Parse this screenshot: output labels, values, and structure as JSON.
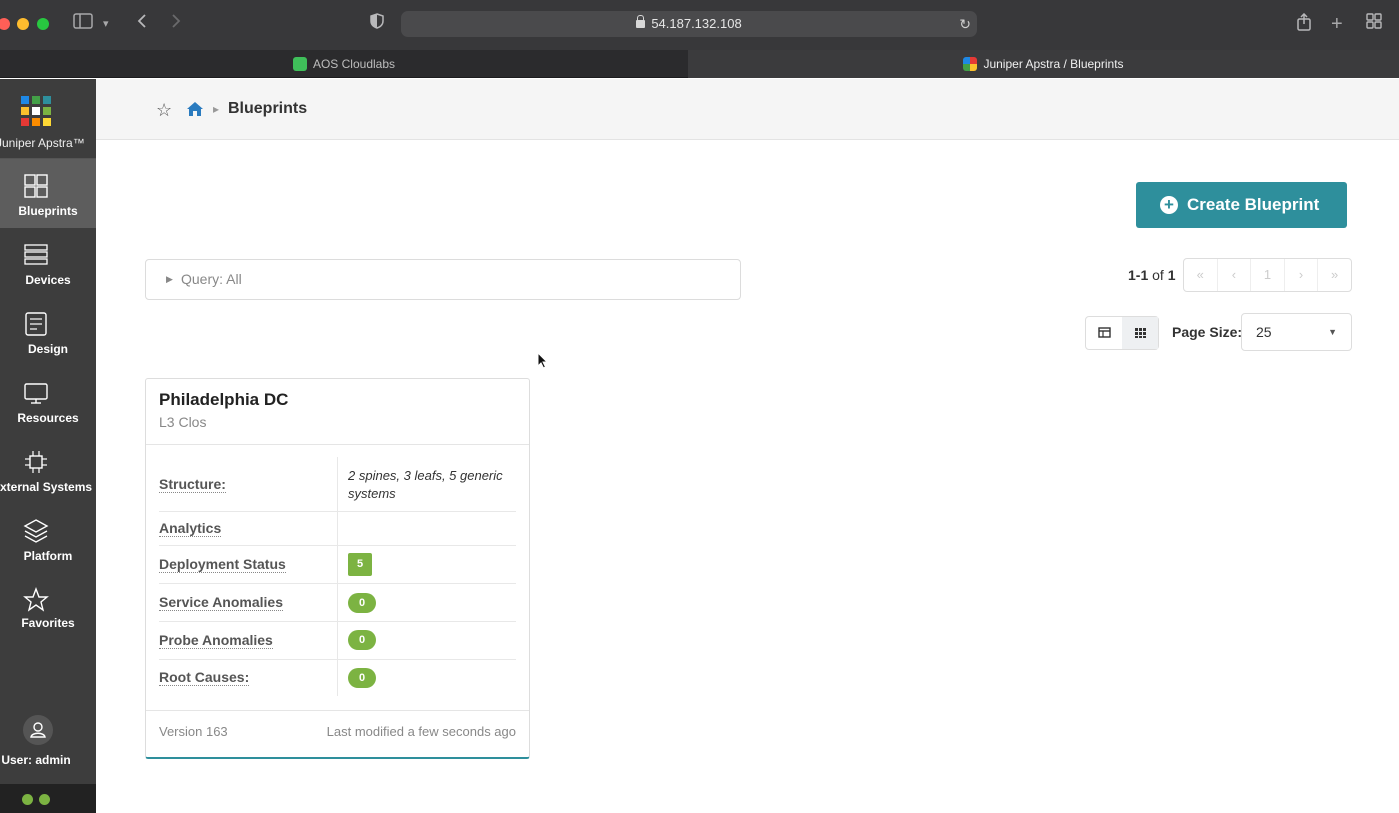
{
  "browser": {
    "url": "54.187.132.108",
    "tabs": [
      {
        "label": "AOS Cloudlabs",
        "active": false
      },
      {
        "label": "Juniper Apstra / Blueprints",
        "active": true
      }
    ]
  },
  "sidebar": {
    "brand": "Juniper Apstra™",
    "items": [
      {
        "label": "Blueprints",
        "icon": "blueprints-icon",
        "active": true
      },
      {
        "label": "Devices",
        "icon": "devices-icon",
        "active": false
      },
      {
        "label": "Design",
        "icon": "design-icon",
        "active": false
      },
      {
        "label": "Resources",
        "icon": "resources-icon",
        "active": false
      },
      {
        "label": "External Systems",
        "icon": "external-systems-icon",
        "active": false
      },
      {
        "label": "Platform",
        "icon": "platform-icon",
        "active": false
      },
      {
        "label": "Favorites",
        "icon": "star-icon",
        "active": false
      }
    ],
    "user": "User: admin"
  },
  "header": {
    "title": "Blueprints"
  },
  "toolbar": {
    "create_label": "Create Blueprint",
    "query_label": "Query: All",
    "page_range": "1-1",
    "page_of": "of",
    "page_total": "1",
    "pager_current": "1",
    "page_size_label": "Page Size:",
    "page_size_value": "25"
  },
  "blueprint_card": {
    "name": "Philadelphia DC",
    "type": "L3 Clos",
    "rows": {
      "structure_label": "Structure:",
      "structure_value": "2 spines, 3 leafs, 5 generic systems",
      "analytics_label": "Analytics",
      "deployment_label": "Deployment Status",
      "deployment_value": "5",
      "service_label": "Service Anomalies",
      "service_value": "0",
      "probe_label": "Probe Anomalies",
      "probe_value": "0",
      "root_label": "Root Causes:",
      "root_value": "0"
    },
    "version": "Version 163",
    "modified": "Last modified a few seconds ago"
  },
  "colors": {
    "accent": "#2e8f9c",
    "success": "#7cb342",
    "sidebar": "#3d3d3d"
  }
}
